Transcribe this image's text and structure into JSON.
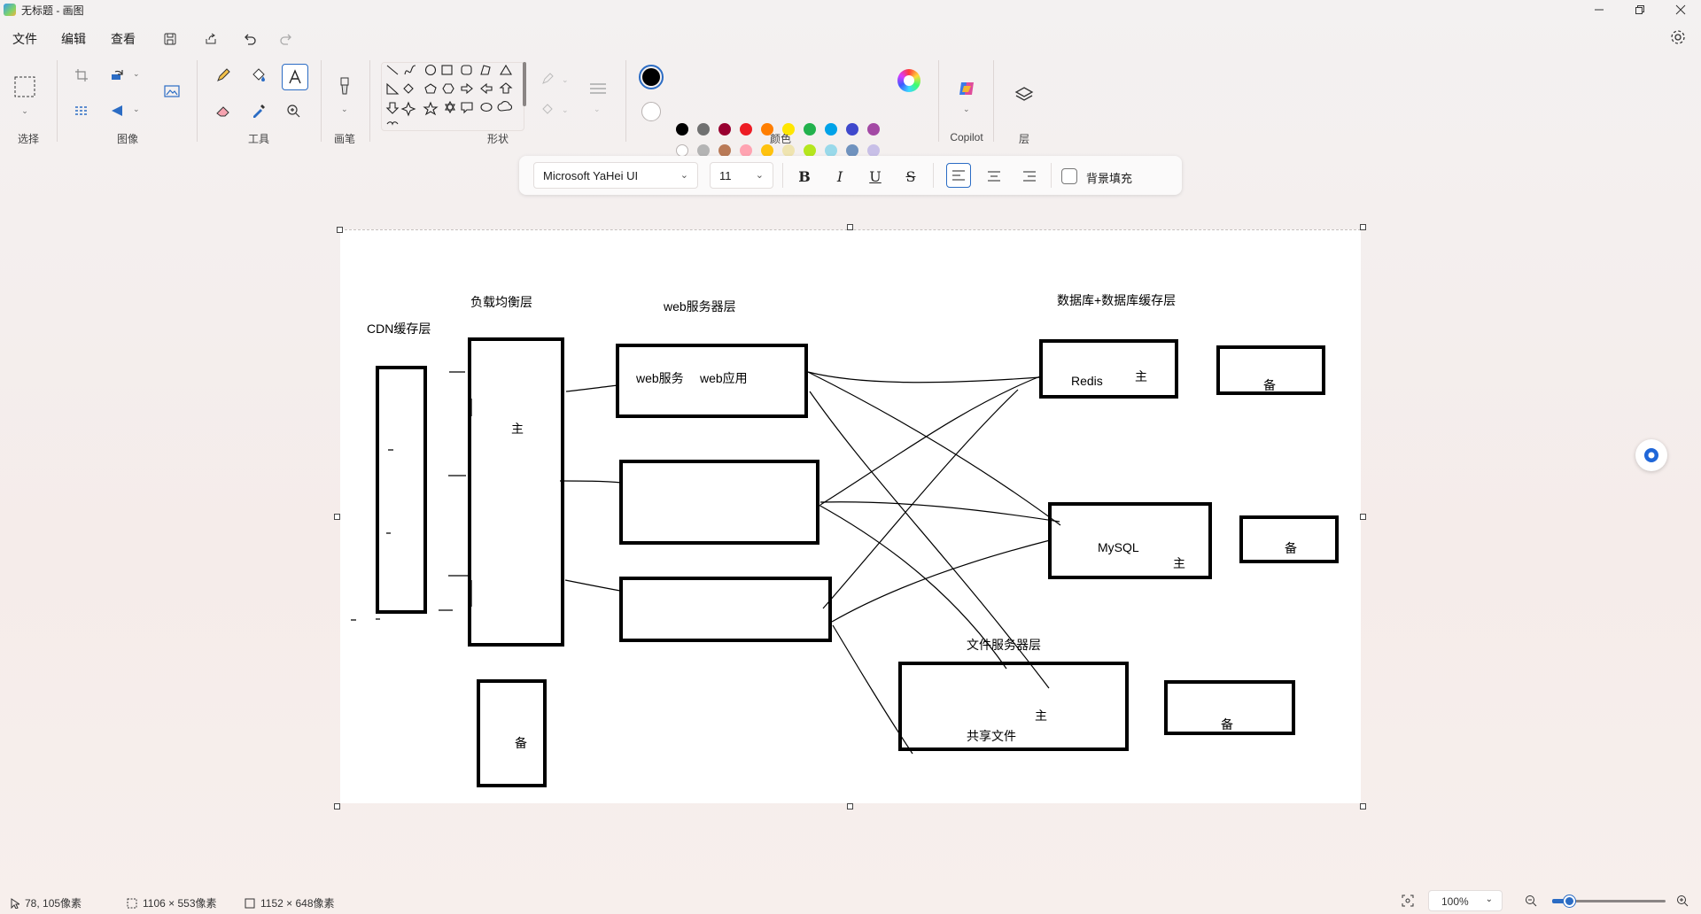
{
  "window": {
    "title": "无标题 - 画图"
  },
  "menu": {
    "file": "文件",
    "edit": "编辑",
    "view": "查看"
  },
  "ribbon": {
    "groups": {
      "select": "选择",
      "image": "图像",
      "tools": "工具",
      "brush": "画笔",
      "shapes": "形状",
      "colors": "颜色",
      "copilot": "Copilot",
      "layers": "层"
    },
    "colors": {
      "current_primary": "#000000",
      "current_secondary": "#ffffff",
      "row1": [
        "#000000",
        "#707070",
        "#990030",
        "#ed1c24",
        "#ff7e00",
        "#ffe600",
        "#22b14c",
        "#00a2e8",
        "#3f48cc",
        "#a349a4"
      ],
      "row2": [
        "#ffffff",
        "#b4b4b4",
        "#b97a57",
        "#ffa3b1",
        "#ffc20e",
        "#efe4b0",
        "#b5e61d",
        "#99d9ea",
        "#7092be",
        "#c8bfe7"
      ]
    }
  },
  "text_format": {
    "font": "Microsoft YaHei UI",
    "size": "11",
    "background_fill_label": "背景填充"
  },
  "drawing": {
    "labels": {
      "cdn": "CDN缓存层",
      "lb": "负载均衡层",
      "web": "web服务器层",
      "db": "数据库+数据库缓存层",
      "web_service": "web服务",
      "web_app": "web应用",
      "lb_main": "主",
      "lb_backup": "备",
      "redis": "Redis",
      "redis_main": "主",
      "redis_backup": "备",
      "mysql": "MySQL",
      "mysql_main": "主",
      "mysql_backup": "备",
      "file_layer": "文件服务器层",
      "file_main": "主",
      "shared_files": "共享文件",
      "file_backup": "备"
    }
  },
  "status": {
    "cursor_pos": "78, 105像素",
    "selection_size": "1106 × 553像素",
    "canvas_size": "1152 × 648像素",
    "zoom": "100%"
  }
}
